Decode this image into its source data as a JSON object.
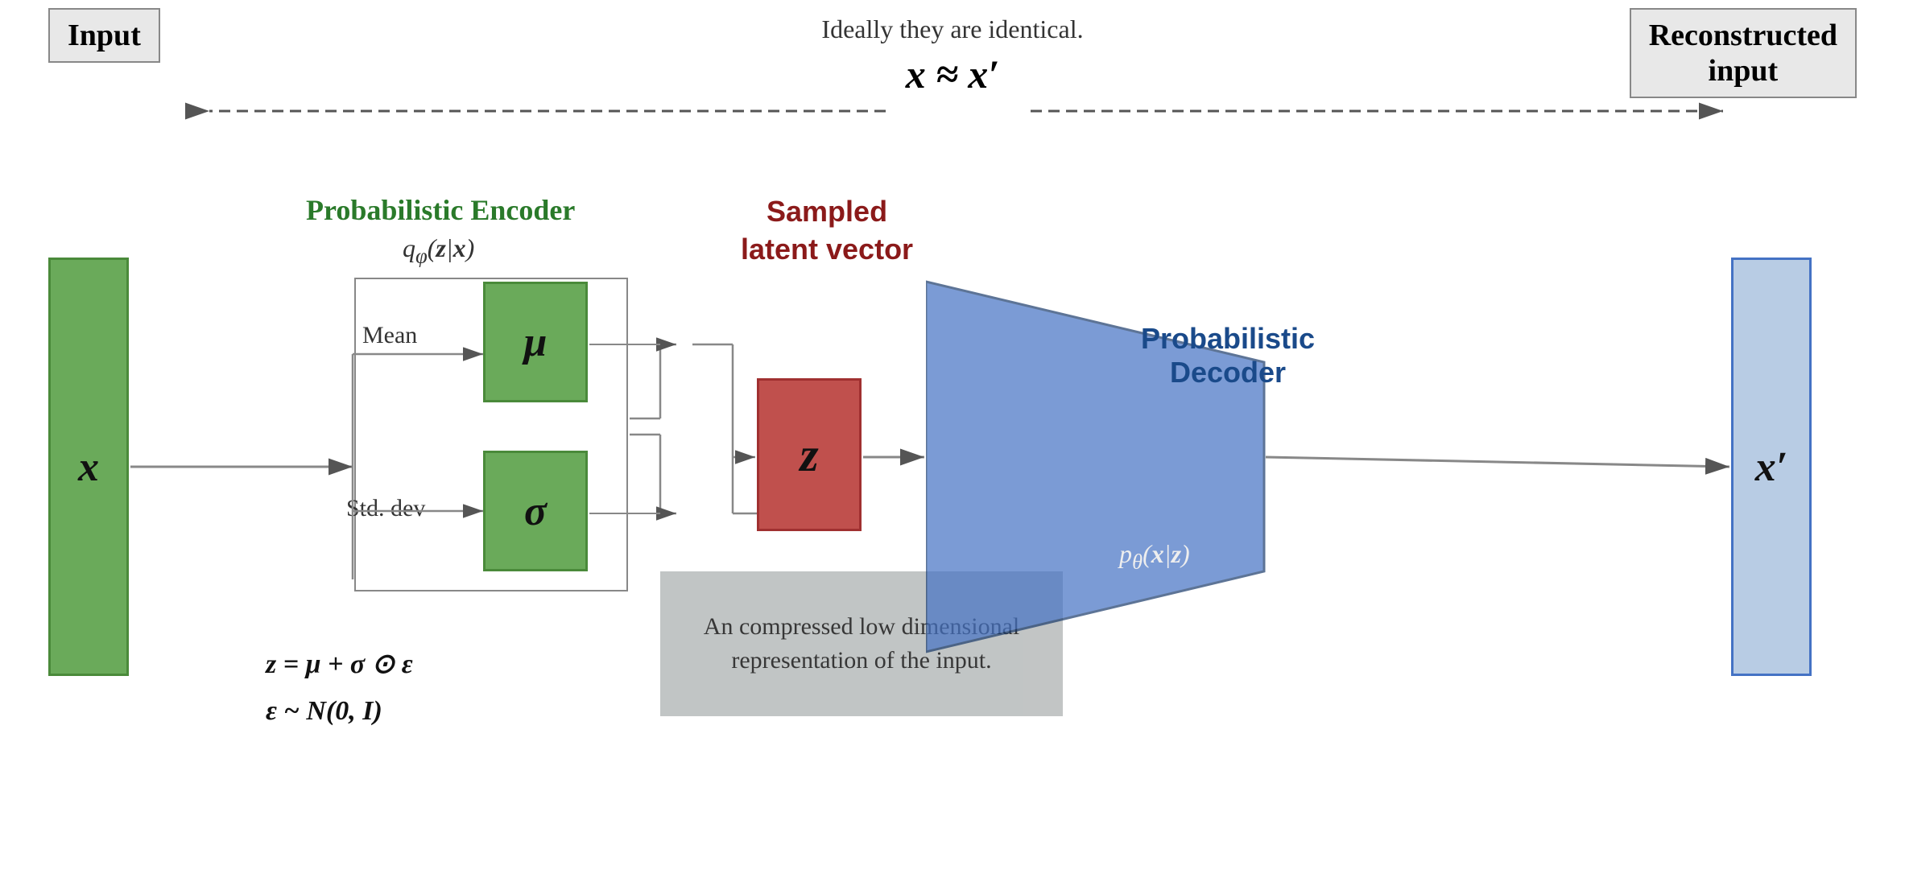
{
  "top": {
    "input_label": "Input",
    "reconstructed_label": "Reconstructed\ninput",
    "identical_text": "Ideally they are identical.",
    "approx_formula": "x ≈ x′"
  },
  "diagram": {
    "input_var": "x",
    "output_var": "x′",
    "encoder_title": "Probabilistic Encoder",
    "encoder_formula": "qφ(z|x)",
    "mean_label": "μ",
    "mean_text": "Mean",
    "sigma_label": "σ",
    "stddev_text": "Std. dev",
    "latent_label": "Sampled\nlatent vector",
    "latent_var": "z",
    "reparam_formula": "z = μ + σ ⊙ ε",
    "epsilon_formula": "ε ~ N(0, I)",
    "callout_text": "An compressed low dimensional representation of the input.",
    "decoder_title": "Probabilistic\nDecoder",
    "decoder_formula": "pθ(x|z)"
  }
}
